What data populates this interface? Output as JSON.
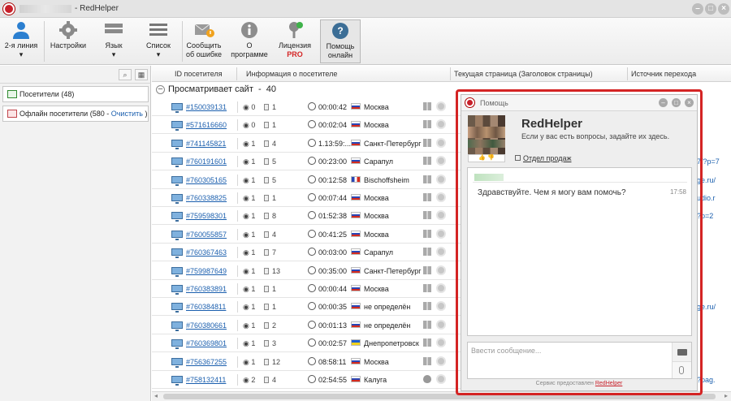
{
  "window": {
    "title": "- RedHelper"
  },
  "toolbar": {
    "items": [
      {
        "label": "2-я линия",
        "icon": "user-icon"
      },
      {
        "label": "Настройки",
        "icon": "gear-icon"
      },
      {
        "label": "Язык",
        "icon": "language-icon"
      },
      {
        "label": "Список",
        "icon": "list-icon"
      },
      {
        "label": "Сообщить об ошибке",
        "l1": "Сообщить",
        "l2": "об ошибке",
        "icon": "envelope-warning-icon"
      },
      {
        "label": "О программе",
        "l1": "О",
        "l2": "программе",
        "icon": "info-icon"
      },
      {
        "label": "Лицензия PRO",
        "l1": "Лицензия",
        "l2": "PRO",
        "icon": "key-icon"
      },
      {
        "label": "Помощь онлайн",
        "l1": "Помощь",
        "l2": "онлайн",
        "icon": "help-icon"
      }
    ]
  },
  "left_pane": {
    "visitors": "Посетители (48)",
    "offline": "Офлайн посетители (580 -",
    "clear": "Очистить",
    "close_paren": ")"
  },
  "columns": [
    "ID посетителя",
    "Информация о посетителе",
    "Текущая страница (Заголовок страницы)",
    "Источник перехода"
  ],
  "group": {
    "label": "Просматривает сайт",
    "count": "40"
  },
  "rows": [
    {
      "id": "#150039131",
      "views": "0",
      "pages": "1",
      "time": "00:00:42",
      "city": "Москва",
      "flag": "ru",
      "os": "win"
    },
    {
      "id": "#571616660",
      "views": "0",
      "pages": "1",
      "time": "00:02:04",
      "city": "Москва",
      "flag": "ru",
      "os": "win"
    },
    {
      "id": "#741145821",
      "views": "1",
      "pages": "4",
      "time": "1.13:59:...",
      "city": "Санкт-Петербург",
      "flag": "ru",
      "os": "win"
    },
    {
      "id": "#760191601",
      "views": "1",
      "pages": "5",
      "time": "00:23:00",
      "city": "Сарапул",
      "flag": "ru",
      "os": "win"
    },
    {
      "id": "#760305165",
      "views": "1",
      "pages": "5",
      "time": "00:12:58",
      "city": "Bischoffsheim",
      "flag": "fr",
      "os": "win"
    },
    {
      "id": "#760338825",
      "views": "1",
      "pages": "1",
      "time": "00:07:44",
      "city": "Москва",
      "flag": "ru",
      "os": "win"
    },
    {
      "id": "#759598301",
      "views": "1",
      "pages": "8",
      "time": "01:52:38",
      "city": "Москва",
      "flag": "ru",
      "os": "win"
    },
    {
      "id": "#760055857",
      "views": "1",
      "pages": "4",
      "time": "00:41:25",
      "city": "Москва",
      "flag": "ru",
      "os": "win"
    },
    {
      "id": "#760367463",
      "views": "1",
      "pages": "7",
      "time": "00:03:00",
      "city": "Сарапул",
      "flag": "ru",
      "os": "win"
    },
    {
      "id": "#759987649",
      "views": "1",
      "pages": "13",
      "time": "00:35:00",
      "city": "Санкт-Петербург",
      "flag": "ru",
      "os": "win"
    },
    {
      "id": "#760383891",
      "views": "1",
      "pages": "1",
      "time": "00:00:44",
      "city": "Москва",
      "flag": "ru",
      "os": "win"
    },
    {
      "id": "#760384811",
      "views": "1",
      "pages": "1",
      "time": "00:00:35",
      "city": "не определён",
      "flag": "ru",
      "os": "win"
    },
    {
      "id": "#760380661",
      "views": "1",
      "pages": "2",
      "time": "00:01:13",
      "city": "не определён",
      "flag": "ru",
      "os": "win"
    },
    {
      "id": "#760369801",
      "views": "1",
      "pages": "3",
      "time": "00:02:57",
      "city": "Днепропетровск",
      "flag": "ua",
      "os": "win"
    },
    {
      "id": "#756367255",
      "views": "1",
      "pages": "12",
      "time": "08:58:11",
      "city": "Москва",
      "flag": "ru",
      "os": "win"
    },
    {
      "id": "#758132411",
      "views": "2",
      "pages": "4",
      "time": "02:54:55",
      "city": "Калуга",
      "flag": "ru",
      "os": "apple"
    }
  ],
  "right_snippets": [
    {
      "row": 3,
      "text": "7/?p=7"
    },
    {
      "row": 4,
      "text": "ge.ru/"
    },
    {
      "row": 5,
      "text": "udio.r"
    },
    {
      "row": 6,
      "text": "?p=2"
    },
    {
      "row": 11,
      "text": "ge.ru/"
    },
    {
      "row": 15,
      "text": "?pag."
    }
  ],
  "chat": {
    "title": "Помощь",
    "name": "RedHelper",
    "subtitle": "Если у вас есть вопросы, задайте их здесь.",
    "department": "Отдел продаж",
    "message": "Здравствуйте. Чем я могу вам помочь?",
    "message_time": "17:58",
    "input_placeholder": "Ввести сообщение...",
    "footer_prefix": "Сервис предоставлен",
    "footer_link": "RedHelper"
  },
  "colors": {
    "accent": "#c8202a",
    "link": "#1b5fae",
    "highlight_frame": "#d42424"
  }
}
